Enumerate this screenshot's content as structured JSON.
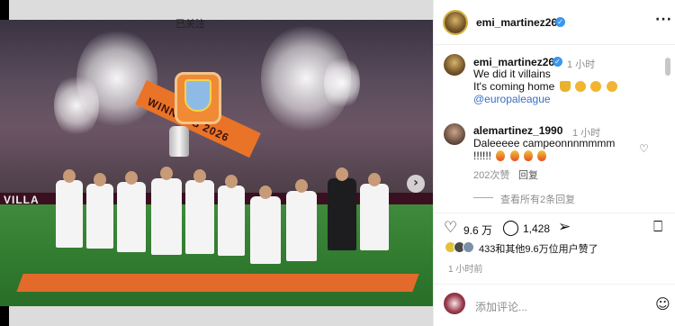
{
  "post": {
    "username": "emi_martinez26",
    "follow_state": "已关注",
    "more_label": "···",
    "caption_time": "1 小时",
    "caption_line1": "We did it villains",
    "caption_line2": "It's coming home",
    "caption_mention": "@europaleague"
  },
  "photo": {
    "board_text": "VILLA",
    "banner_text": "WINNERS 2026",
    "next_arrow": "›",
    "slide_count": 8,
    "active_slide": 1
  },
  "comment": {
    "username": "alemartinez_1990",
    "time": "1 小时",
    "text_line1": "Daleeeee campeonnnmmmm",
    "text_line2": "!!!!!!",
    "likes": "202次赞",
    "reply_label": "回复",
    "view_replies": "查看所有2条回复"
  },
  "actions": {
    "like_count": "9.6 万",
    "comment_count": "1,428",
    "likes_summary": "433和其他9.6万位用户赞了",
    "post_time": "1 小时前"
  },
  "composer": {
    "placeholder": "添加评论..."
  },
  "icons": {
    "like": "heart-icon",
    "comment": "comment-icon",
    "share": "share-icon",
    "save": "bookmark-icon",
    "emoji": "emoji-icon"
  },
  "colors": {
    "link": "#3b6fc4",
    "verified": "#3897f0",
    "banner": "#e97327",
    "pitch": "#2f7a2e"
  }
}
